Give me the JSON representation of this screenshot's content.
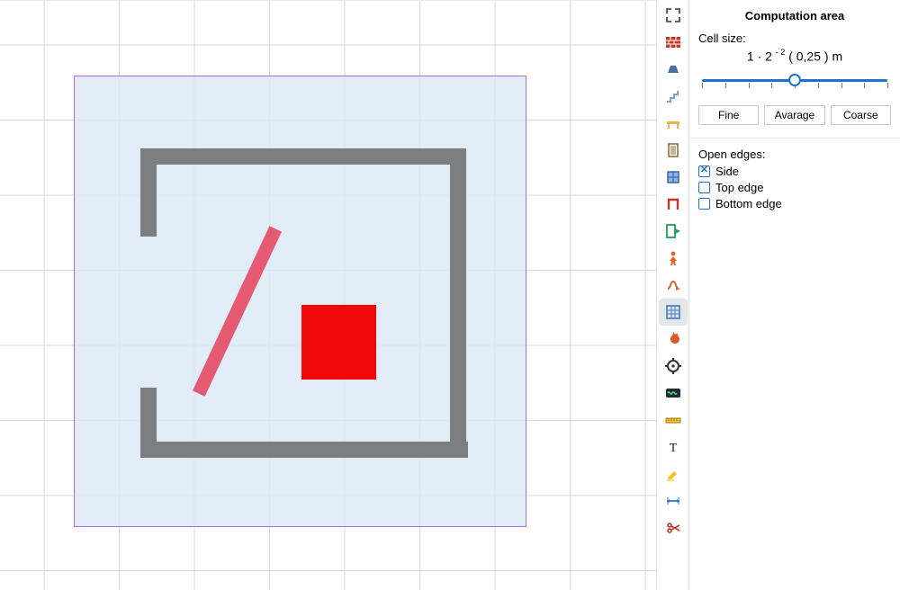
{
  "panel": {
    "title": "Computation area",
    "cell_size_label": "Cell size:",
    "cell_expr_base": "1 · 2",
    "cell_expr_exp": "- 2",
    "cell_expr_result": "( 0,25 ) m",
    "presets": {
      "fine": "Fine",
      "average": "Avarage",
      "coarse": "Coarse"
    },
    "open_edges_label": "Open edges:",
    "edges": {
      "side": "Side",
      "top": "Top edge",
      "bottom": "Bottom edge"
    },
    "edge_checked": {
      "side": true,
      "top": false,
      "bottom": false
    }
  },
  "slider": {
    "value_pct": 50,
    "ticks": 9
  },
  "tools": [
    {
      "name": "select-tool",
      "icon": "arrows-out"
    },
    {
      "name": "wall-tool",
      "icon": "brick"
    },
    {
      "name": "roof-tool",
      "icon": "trapezoid"
    },
    {
      "name": "stair-tool",
      "icon": "stair"
    },
    {
      "name": "table-tool",
      "icon": "table"
    },
    {
      "name": "door-tool",
      "icon": "door"
    },
    {
      "name": "window-tool",
      "icon": "window"
    },
    {
      "name": "opening-tool",
      "icon": "opening"
    },
    {
      "name": "exit-tool",
      "icon": "exit"
    },
    {
      "name": "person-tool",
      "icon": "person"
    },
    {
      "name": "path-tool",
      "icon": "path"
    },
    {
      "name": "computation-area-tool",
      "icon": "comp-area",
      "active": true
    },
    {
      "name": "fire-tool",
      "icon": "fire"
    },
    {
      "name": "target-tool",
      "icon": "target"
    },
    {
      "name": "detector-tool",
      "icon": "wave"
    },
    {
      "name": "measure-tool",
      "icon": "ruler"
    },
    {
      "name": "text-tool",
      "icon": "text"
    },
    {
      "name": "highlight-tool",
      "icon": "marker"
    },
    {
      "name": "dimension-tool",
      "icon": "dim"
    },
    {
      "name": "cut-tool",
      "icon": "scissors"
    }
  ]
}
